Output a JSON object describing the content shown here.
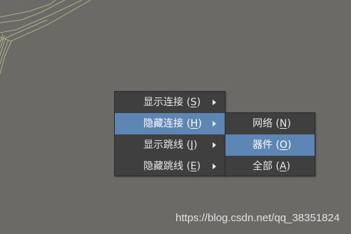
{
  "menu": {
    "items": [
      {
        "label": "显示连接",
        "shortcut": "S",
        "open": "(",
        "close": ")"
      },
      {
        "label": "隐藏连接",
        "shortcut": "H",
        "open": "(",
        "close": ")"
      },
      {
        "label": "显示跳线",
        "shortcut": "J",
        "open": "(",
        "close": ")"
      },
      {
        "label": "隐藏跳线",
        "shortcut": "E",
        "open": "(",
        "close": ")"
      }
    ]
  },
  "submenu": {
    "items": [
      {
        "label": "网络",
        "shortcut": "N",
        "open": "(",
        "close": ")"
      },
      {
        "label": "器件",
        "shortcut": "O",
        "open": "(",
        "close": ")"
      },
      {
        "label": "全部",
        "shortcut": "A",
        "open": "(",
        "close": ")"
      }
    ]
  },
  "watermark": {
    "text": "https://blog.csdn.net/qq_38351824"
  },
  "colors": {
    "background": "#6b6a67",
    "menu": "#3f3f3f",
    "highlight": "#5e86b5",
    "wire": "#b8bd8a"
  },
  "icons": {
    "submenu_arrow": "chevron-right-icon"
  }
}
